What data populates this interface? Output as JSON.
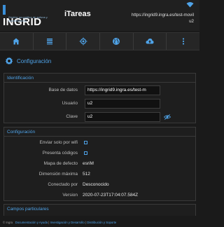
{
  "header": {
    "logo_text": "INGRID",
    "logo_subtitle": "Gestión geográfica de activos y mantenimiento",
    "app_title": "iTareas",
    "url_line1": "https://ingrid9.ingra.es/test-movil",
    "url_line2": "u2",
    "wifi_icon": "wifi-icon"
  },
  "toolbar": {
    "items": [
      {
        "icon": "home-icon"
      },
      {
        "icon": "list-icon"
      },
      {
        "icon": "target-icon"
      },
      {
        "icon": "globe-icon"
      },
      {
        "icon": "cloud-upload-icon"
      },
      {
        "icon": "more-vertical-icon"
      }
    ]
  },
  "page": {
    "title": "Configuración",
    "title_icon": "gear-icon"
  },
  "identificacion": {
    "header": "Identificación",
    "base_datos_label": "Base de datos",
    "base_datos_value": "https://ingrid9.ingra.es/test-m",
    "usuario_label": "Usuario",
    "usuario_value": "u2",
    "clave_label": "Clave",
    "clave_value": "u2"
  },
  "configuracion": {
    "header": "Configuración",
    "enviar_wifi_label": "Enviar solo por wifi",
    "enviar_wifi_checked": false,
    "presenta_codigos_label": "Presenta códigos",
    "presenta_codigos_checked": false,
    "mapa_defecto_label": "Mapa de defecto",
    "mapa_defecto_value": "esriM",
    "dimension_maxima_label": "Dimensión máxima",
    "dimension_maxima_value": "512",
    "conectado_por_label": "Conectado por",
    "conectado_por_value": "Desconocido",
    "version_label": "Version",
    "version_value": "2020-07-23T17:04:07.584Z"
  },
  "campos": {
    "header": "Campos particulares"
  },
  "footer": {
    "copyright": "© Ingra",
    "link1": "Documentación y Ayuda",
    "sep1": " | ",
    "link2": "Investigación y Desarrollo",
    "sep2": " | ",
    "link3": "Distribución y Soporte"
  },
  "colors": {
    "accent": "#4fa3e8",
    "background": "#1a1a1a",
    "panel": "#1e1e1e"
  }
}
